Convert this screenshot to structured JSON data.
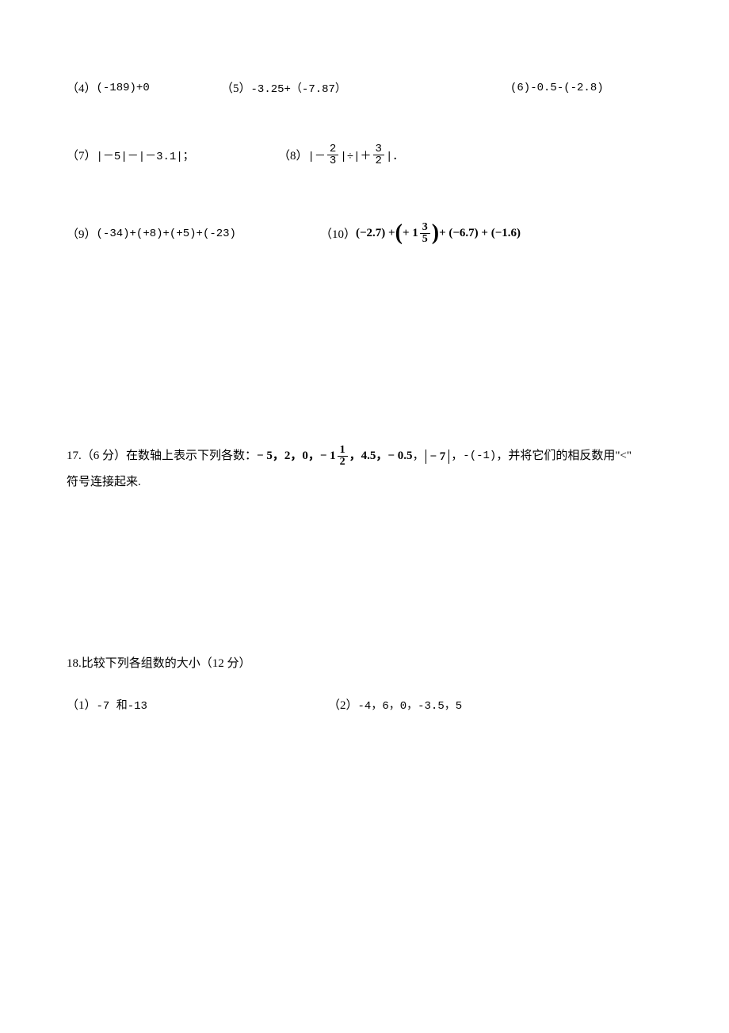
{
  "row456": {
    "p4": {
      "label": "（4）",
      "expr": "(-189)+0"
    },
    "p5": {
      "label": "（5）",
      "expr": "-3.25+（-7.87）"
    },
    "p6": {
      "label": "(6)",
      "expr": "-0.5-(-2.8)"
    }
  },
  "row78": {
    "p7": {
      "label": "（7）",
      "pre": "|－5|－|－3.1|；"
    },
    "p8": {
      "label": "（8）",
      "pre": "|－",
      "frac1n": "2",
      "frac1d": "3",
      "mid": "|÷|＋",
      "frac2n": "3",
      "frac2d": "2",
      "post": "|．"
    }
  },
  "row910": {
    "p9": {
      "label": "（9）",
      "expr": "(-34)+(+8)+(+5)+(-23)"
    },
    "p10": {
      "label": "（10）",
      "a": "(−2.7) + ",
      "whole": "+ 1",
      "fn": "3",
      "fd": "5",
      "b": " + (−6.7) + (−1.6)"
    }
  },
  "q17": {
    "prefix": "17.（6 分）在数轴上表示下列各数：",
    "nums": "− 5，2，0，",
    "mixed_whole": "− 1",
    "mixed_n": "1",
    "mixed_d": "2",
    "nums2": "，4.5，− 0.5",
    "comma1": "，",
    "abs7": "− 7",
    "comma2": " ，",
    "neg_neg1": "-(-1)",
    "tail": "，并将它们的相反数用\"<\"",
    "line2": "符号连接起来."
  },
  "q18": {
    "title": "18.比较下列各组数的大小（12 分）",
    "p1": {
      "label": "（1）",
      "text": "-7 和-13"
    },
    "p2": {
      "label": "（2）",
      "text": "-4，6，0，-3.5，5"
    }
  }
}
